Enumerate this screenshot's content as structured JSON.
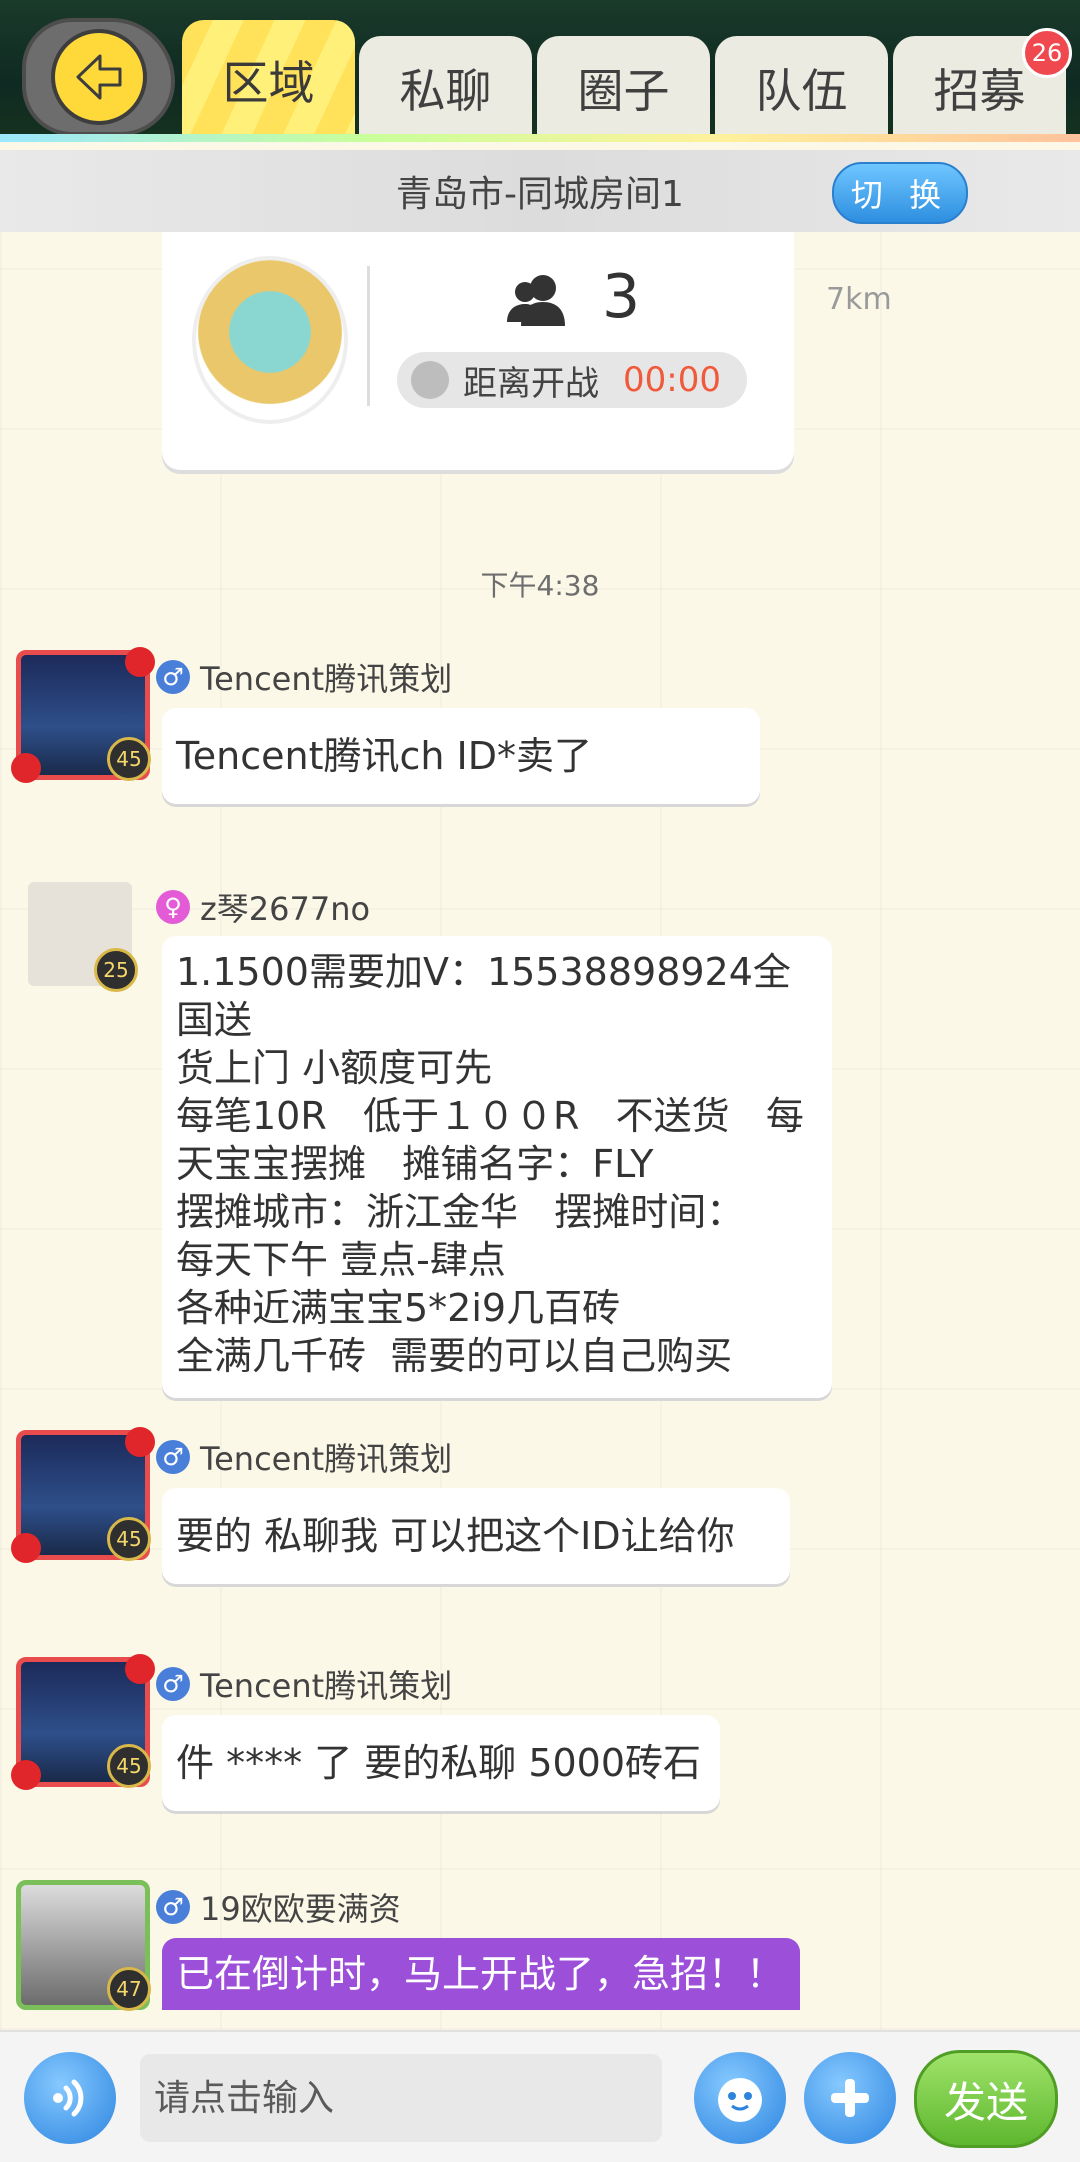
{
  "header": {
    "tabs": [
      {
        "label": "区域"
      },
      {
        "label": "私聊"
      },
      {
        "label": "圈子"
      },
      {
        "label": "队伍"
      },
      {
        "label": "招募",
        "badge": "26"
      }
    ]
  },
  "room": {
    "title": "青岛市-同城房间1",
    "switch_label": "切 换",
    "player_count": "3",
    "countdown_label": "距离开战",
    "countdown_time": "00:00",
    "distance": "7km"
  },
  "chat": {
    "timestamp": "下午4:38",
    "messages": [
      {
        "sender": "Tencent腾讯策划",
        "gender": "♂",
        "level": "45",
        "text": "Tencent腾讯ch ID*卖了"
      },
      {
        "sender": "z琴2677no",
        "gender": "♀",
        "level": "25",
        "text": "1.1500需要加V：15538898924全国送\n货上门 小额度可先\n每笔10R   低于１００R   不送货   每\n天宝宝摆摊   摊铺名字：FLY\n摆摊城市：浙江金华   摆摊时间：\n每天下午 壹点-肆点\n各种近满宝宝5*2i9几百砖\n全满几千砖  需要的可以自己购买"
      },
      {
        "sender": "Tencent腾讯策划",
        "gender": "♂",
        "level": "45",
        "text": "要的 私聊我 可以把这个ID让给你"
      },
      {
        "sender": "Tencent腾讯策划",
        "gender": "♂",
        "level": "45",
        "text": "件 **** 了 要的私聊 5000砖石"
      },
      {
        "sender": "19欧欧要满资",
        "gender": "♂",
        "level": "47",
        "text": "已在倒计时，马上开战了，急招！！"
      }
    ]
  },
  "input": {
    "placeholder": "请点击输入",
    "send_label": "发送"
  },
  "colors": {
    "accent_yellow": "#ffe25a",
    "blue_button": "#2e8fe0",
    "send_green": "#5eb72e",
    "recruit_purple": "#9c4fd8",
    "countdown_red": "#f05a3a"
  }
}
